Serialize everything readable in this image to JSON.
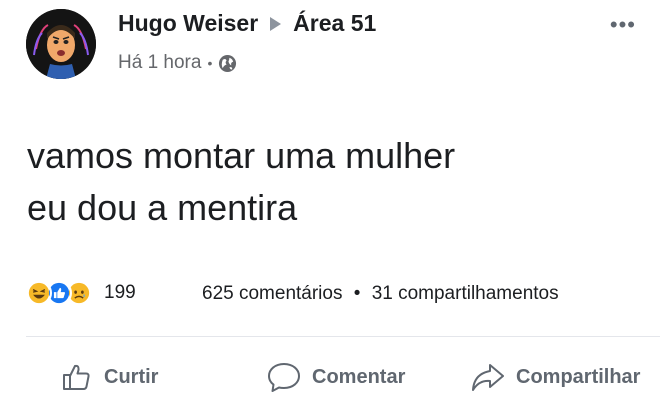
{
  "post": {
    "author": "Hugo Weiser",
    "group": "Área 51",
    "time": "Há 1 hora",
    "more_label": "•••",
    "text_lines": [
      "vamos montar uma mulher",
      "eu dou a mentira"
    ]
  },
  "engagement": {
    "reaction_count": "199",
    "comments": "625 comentários",
    "separator": "•",
    "shares": "31 compartilhamentos",
    "reactions": [
      "haha",
      "like",
      "sad"
    ]
  },
  "actions": {
    "like": "Curtir",
    "comment": "Comentar",
    "share": "Compartilhar"
  },
  "colors": {
    "like_blue": "#1877f2",
    "reaction_yellow": "#f7b928",
    "secondary_text": "#65676b",
    "action_text": "#606770"
  }
}
